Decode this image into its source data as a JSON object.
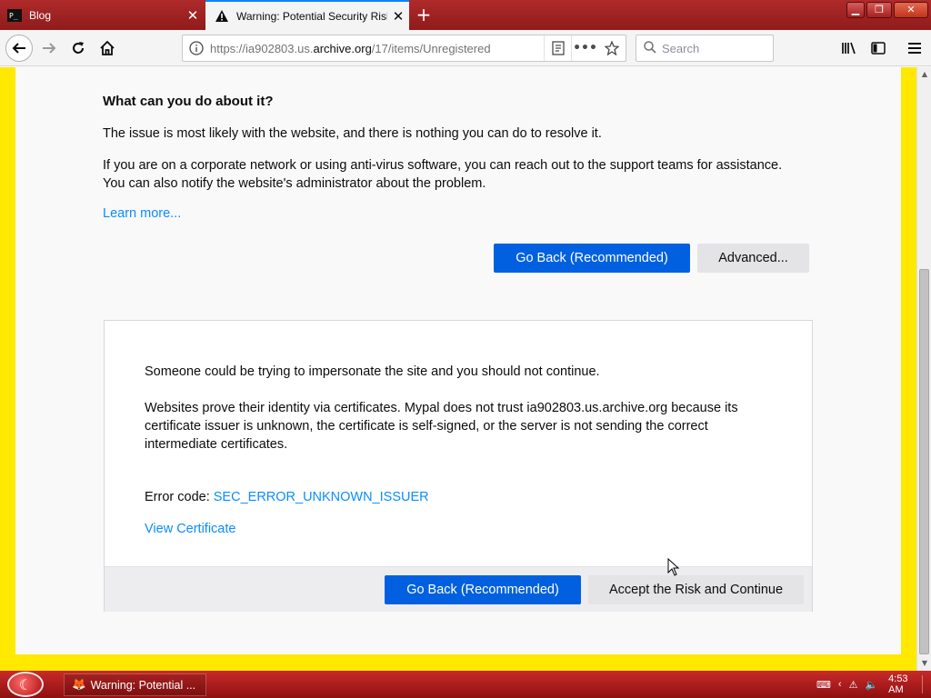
{
  "tabs": [
    {
      "title": "Blog",
      "favicon": "terminal-icon"
    },
    {
      "title": "Warning: Potential Security Risk Ahead",
      "favicon": "warning-triangle-icon",
      "active": true
    }
  ],
  "nav": {
    "url_prefix": "https://ia902803.us.",
    "url_host": "archive.org",
    "url_suffix": "/17/items/Unregistered",
    "search_placeholder": "Search"
  },
  "page": {
    "heading": "What can you do about it?",
    "para_issue": "The issue is most likely with the website, and there is nothing you can do to resolve it.",
    "para_corporate_1": "If you are on a corporate network or using anti-virus software, you can reach out to the support teams for assistance.",
    "para_corporate_2": "You can also notify the website's administrator about the problem.",
    "learn_more": "Learn more...",
    "go_back_label": "Go Back (Recommended)",
    "advanced_label": "Advanced..."
  },
  "advanced": {
    "impersonate_text": "Someone could be trying to impersonate the site and you should not continue.",
    "cert_line_1": "Websites prove their identity via certificates. Mypal does not trust ia902803.us.archive.org because its",
    "cert_line_2": "certificate issuer is unknown, the certificate is self-signed, or the server is not sending the correct",
    "cert_line_3": "intermediate certificates.",
    "error_code_label": "Error code:",
    "error_code": "SEC_ERROR_UNKNOWN_ISSUER",
    "view_certificate": "View Certificate",
    "go_back_label": "Go Back (Recommended)",
    "accept_label": "Accept the Risk and Continue"
  },
  "taskbar": {
    "task_title": "Warning: Potential ...",
    "clock": "4:53 AM"
  },
  "colors": {
    "accent_blue": "#0060df",
    "link_blue": "#0a8dff",
    "highlight_yellow": "#ffe900",
    "chrome_red": "#a82222"
  }
}
